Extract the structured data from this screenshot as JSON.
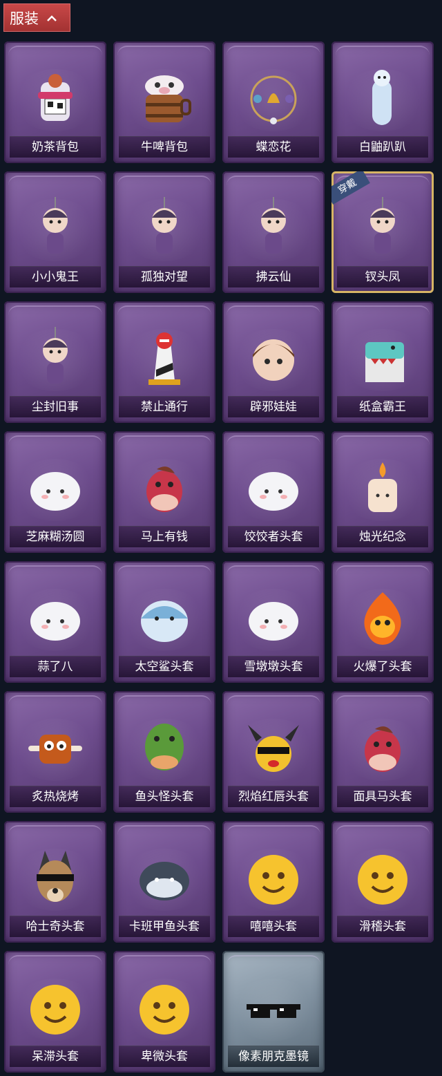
{
  "header": {
    "title": "服装"
  },
  "items": [
    {
      "label": "奶茶背包",
      "icon": "milk-tea-backpack-icon",
      "art": "cup"
    },
    {
      "label": "牛啤背包",
      "icon": "cow-beer-backpack-icon",
      "art": "barrel"
    },
    {
      "label": "蝶恋花",
      "icon": "butterfly-flower-ornament-icon",
      "art": "bell"
    },
    {
      "label": "白鼬趴趴",
      "icon": "white-weasel-icon",
      "art": "weasel"
    },
    {
      "label": "小小鬼王",
      "icon": "little-ghost-king-charm-icon",
      "art": "doll"
    },
    {
      "label": "孤独对望",
      "icon": "lonely-gaze-charm-icon",
      "art": "doll"
    },
    {
      "label": "拂云仙",
      "icon": "cloud-fairy-charm-icon",
      "art": "doll"
    },
    {
      "label": "钗头凤",
      "icon": "phoenix-hairpin-charm-icon",
      "art": "doll",
      "badge": "穿戴"
    },
    {
      "label": "尘封旧事",
      "icon": "dusty-past-charm-icon",
      "art": "doll"
    },
    {
      "label": "禁止通行",
      "icon": "no-entry-cone-icon",
      "art": "cone"
    },
    {
      "label": "辟邪娃娃",
      "icon": "ward-doll-head-icon",
      "art": "face"
    },
    {
      "label": "纸盒霸王",
      "icon": "cardboard-dino-icon",
      "art": "box"
    },
    {
      "label": "芝麻糊汤圆",
      "icon": "sesame-dumpling-icon",
      "art": "blob"
    },
    {
      "label": "马上有钱",
      "icon": "red-horse-head-icon",
      "art": "horse"
    },
    {
      "label": "饺饺者头套",
      "icon": "dumpling-head-icon",
      "art": "blob"
    },
    {
      "label": "烛光纪念",
      "icon": "candle-head-icon",
      "art": "candle"
    },
    {
      "label": "蒜了八",
      "icon": "garlic-head-icon",
      "art": "blob"
    },
    {
      "label": "太空鲨头套",
      "icon": "space-shark-head-icon",
      "art": "shark"
    },
    {
      "label": "雪墩墩头套",
      "icon": "snowman-head-icon",
      "art": "blob"
    },
    {
      "label": "火爆了头套",
      "icon": "fire-head-icon",
      "art": "fire"
    },
    {
      "label": "炙热烧烤",
      "icon": "bbq-meat-head-icon",
      "art": "meat"
    },
    {
      "label": "鱼头怪头套",
      "icon": "fish-head-icon",
      "art": "fish"
    },
    {
      "label": "烈焰红唇头套",
      "icon": "pikachu-lips-head-icon",
      "art": "pika"
    },
    {
      "label": "面具马头套",
      "icon": "horse-mask-icon",
      "art": "horse"
    },
    {
      "label": "哈士奇头套",
      "icon": "husky-head-icon",
      "art": "dog"
    },
    {
      "label": "卡班甲鱼头套",
      "icon": "whale-head-icon",
      "art": "whale"
    },
    {
      "label": "嘻嘻头套",
      "icon": "grin-emoji-head-icon",
      "art": "emoji"
    },
    {
      "label": "滑稽头套",
      "icon": "funny-emoji-head-icon",
      "art": "emoji"
    },
    {
      "label": "呆滞头套",
      "icon": "dazed-emoji-head-icon",
      "art": "emoji"
    },
    {
      "label": "卑微头套",
      "icon": "humble-emoji-head-icon",
      "art": "emoji"
    },
    {
      "label": "像素朋克墨镜",
      "icon": "pixel-sunglasses-icon",
      "art": "glasses",
      "rarity": "silver"
    }
  ],
  "colors": {
    "bg": "#0f1522",
    "header": "#b23a3a",
    "card": "#6e4d8e",
    "equipped_border": "#d7b565"
  }
}
